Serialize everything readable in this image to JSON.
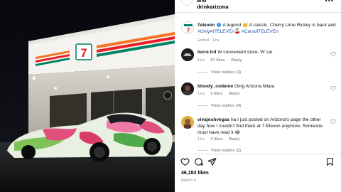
{
  "post": {
    "header": {
      "name_line1": "and",
      "name_line2": "drinkarizona",
      "more_label": "•••"
    },
    "caption": {
      "username": "7eleven",
      "text": "A legend 👑 A classic. Cherry Lime Rickey is back and",
      "hashtags": "#OnlyAt7ELEVEn🍒 #Carsof7ELEVEn",
      "meta": "Edited · 11w"
    },
    "comments": [
      {
        "username": "lucre.trd",
        "text": "W convenient store. W car",
        "time": "11w",
        "likes": "97 likes",
        "reply": "Reply",
        "view_replies": "View replies (3)"
      },
      {
        "username": "bloody_codeine",
        "text": "Omg Arizona Miata",
        "time": "11w",
        "likes": "2 likes",
        "reply": "Reply",
        "view_replies": "View replies (4)"
      },
      {
        "username": "vivajoshvegas",
        "text": "ha I just posted on Arizona's page the other day how I couldn't find them at 7-Eleven anymore. Someone must have read it 😂",
        "time": "11w",
        "likes": "3 likes",
        "reply": "Reply",
        "view_replies": "View replies (2)"
      }
    ],
    "likes_count": "46,183 likes",
    "date": "March 6",
    "icons": {
      "like": "heart-icon",
      "comment": "comment-icon",
      "share": "send-icon",
      "save": "bookmark-icon"
    },
    "colors": {
      "brand_green": "#008163",
      "brand_orange": "#f47321",
      "brand_red": "#ee1c25",
      "hashtag_blue": "#1d52a8",
      "muted_text": "#8e8e8e"
    }
  }
}
